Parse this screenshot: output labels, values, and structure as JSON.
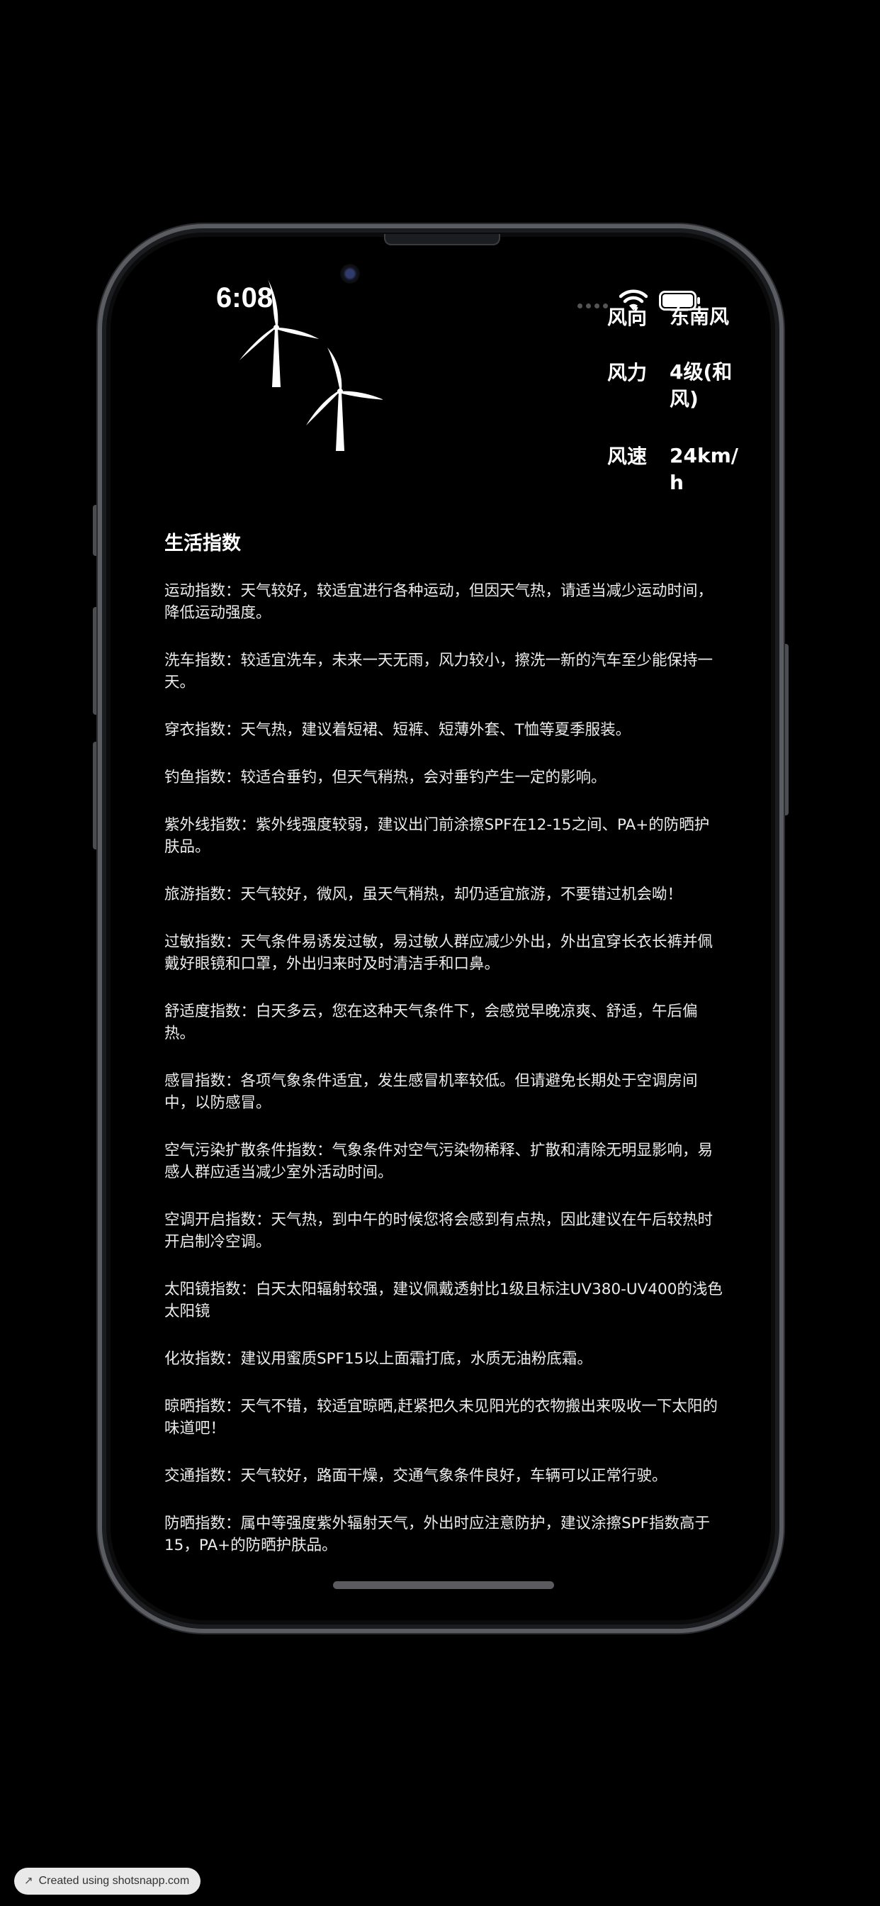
{
  "status_bar": {
    "time": "6:08",
    "icons": [
      "signal-dots-icon",
      "wifi-icon",
      "battery-icon"
    ]
  },
  "wind": {
    "direction_label": "风向",
    "direction_value": "东南风",
    "force_label": "风力",
    "force_value": "4级(和风)",
    "speed_label": "风速",
    "speed_value": "24km/h"
  },
  "life_index": {
    "title": "生活指数",
    "items": [
      "运动指数：天气较好，较适宜进行各种运动，但因天气热，请适当减少运动时间，降低运动强度。",
      "洗车指数：较适宜洗车，未来一天无雨，风力较小，擦洗一新的汽车至少能保持一天。",
      "穿衣指数：天气热，建议着短裙、短裤、短薄外套、T恤等夏季服装。",
      "钓鱼指数：较适合垂钓，但天气稍热，会对垂钓产生一定的影响。",
      "紫外线指数：紫外线强度较弱，建议出门前涂擦SPF在12-15之间、PA+的防晒护肤品。",
      "旅游指数：天气较好，微风，虽天气稍热，却仍适宜旅游，不要错过机会呦！",
      "过敏指数：天气条件易诱发过敏，易过敏人群应减少外出，外出宜穿长衣长裤并佩戴好眼镜和口罩，外出归来时及时清洁手和口鼻。",
      "舒适度指数：白天多云，您在这种天气条件下，会感觉早晚凉爽、舒适，午后偏热。",
      "感冒指数：各项气象条件适宜，发生感冒机率较低。但请避免长期处于空调房间中，以防感冒。",
      "空气污染扩散条件指数：气象条件对空气污染物稀释、扩散和清除无明显影响，易感人群应适当减少室外活动时间。",
      "空调开启指数：天气热，到中午的时候您将会感到有点热，因此建议在午后较热时开启制冷空调。",
      "太阳镜指数：白天太阳辐射较强，建议佩戴透射比1级且标注UV380-UV400的浅色太阳镜",
      "化妆指数：建议用蜜质SPF15以上面霜打底，水质无油粉底霜。",
      "晾晒指数：天气不错，较适宜晾晒,赶紧把久未见阳光的衣物搬出来吸收一下太阳的味道吧！",
      "交通指数：天气较好，路面干燥，交通气象条件良好，车辆可以正常行驶。",
      "防晒指数：属中等强度紫外辐射天气，外出时应注意防护，建议涂擦SPF指数高于15，PA+的防晒护肤品。"
    ]
  },
  "watermark": {
    "icon": "arrow-up-right-icon",
    "text": "Created using shotsnapp.com"
  },
  "colors": {
    "background": "#000000",
    "text": "#ffffff",
    "frame": "#5a5c61"
  }
}
